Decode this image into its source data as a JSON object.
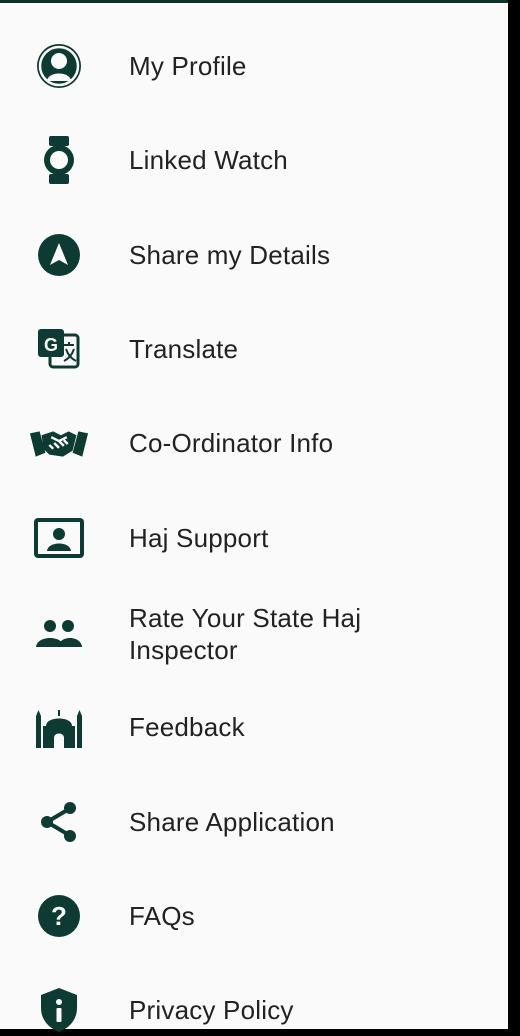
{
  "theme": {
    "accent": "#0d3b33",
    "background": "#fafafa",
    "text": "#222222"
  },
  "menu": {
    "items": [
      {
        "label": "My Profile",
        "icon": "profile-icon"
      },
      {
        "label": "Linked Watch",
        "icon": "watch-icon"
      },
      {
        "label": "Share my Details",
        "icon": "navigation-arrow-icon"
      },
      {
        "label": "Translate",
        "icon": "translate-icon"
      },
      {
        "label": "Co-Ordinator Info",
        "icon": "handshake-icon"
      },
      {
        "label": "Haj Support",
        "icon": "contact-card-icon"
      },
      {
        "label": "Rate Your State Haj Inspector",
        "icon": "group-icon"
      },
      {
        "label": "Feedback",
        "icon": "mosque-icon"
      },
      {
        "label": "Share Application",
        "icon": "share-icon"
      },
      {
        "label": "FAQs",
        "icon": "help-circle-icon"
      },
      {
        "label": "Privacy Policy",
        "icon": "shield-info-icon"
      }
    ]
  }
}
